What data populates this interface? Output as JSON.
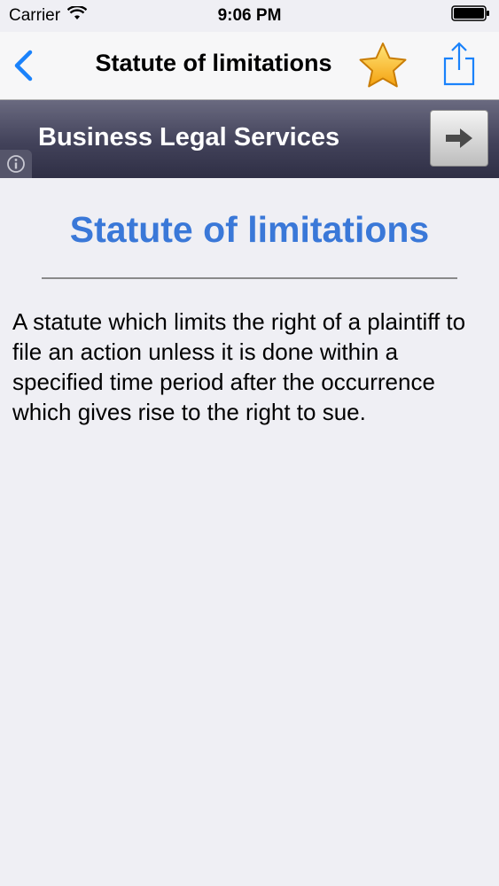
{
  "status_bar": {
    "carrier": "Carrier",
    "time": "9:06 PM"
  },
  "nav_bar": {
    "title": "Statute of limitations",
    "back_icon": "chevron-left-icon",
    "favorite_icon": "star-icon",
    "share_icon": "share-icon",
    "accent_color": "#1a82fb"
  },
  "ad_banner": {
    "text": "Business Legal Services",
    "arrow_icon": "arrow-right-icon",
    "info_icon": "info-icon"
  },
  "content": {
    "heading": "Statute of limitations",
    "heading_color": "#3a78d8",
    "definition": "A statute which limits the right of a plaintiff to file an action unless it is done within a specified time period after the occurrence which gives rise to the right to sue."
  }
}
